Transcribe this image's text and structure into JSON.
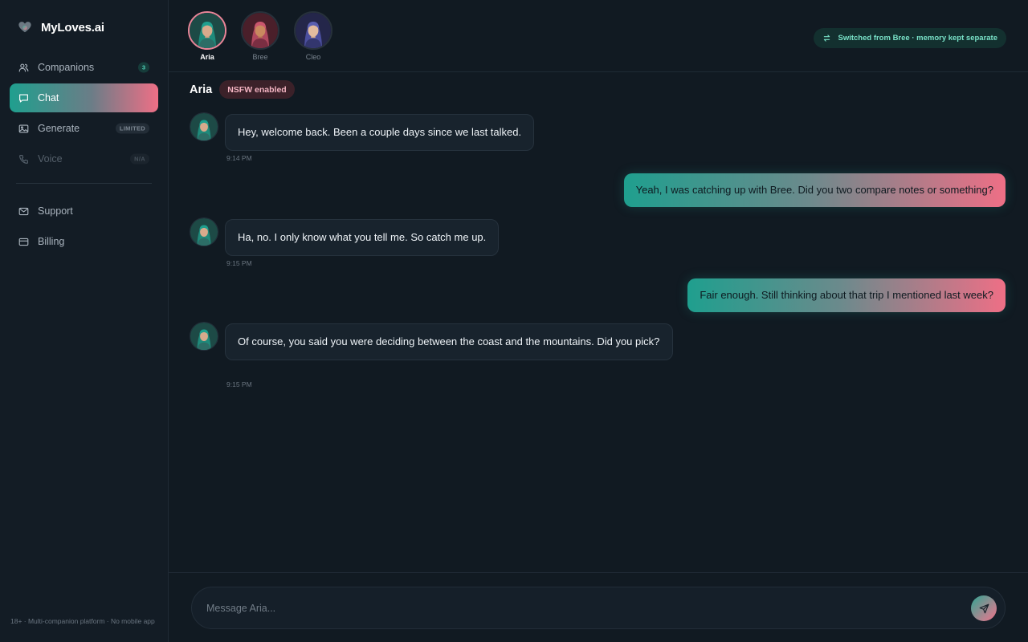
{
  "app": {
    "name": "MyLoves.ai"
  },
  "sidebar": {
    "items": [
      {
        "label": "Companions",
        "icon": "users-icon",
        "badge": "3"
      },
      {
        "label": "Chat",
        "icon": "chat-icon",
        "active": true
      },
      {
        "label": "Generate",
        "icon": "image-icon",
        "badge": "LIMITED"
      },
      {
        "label": "Voice",
        "icon": "phone-icon",
        "badge": "N/A",
        "disabled": true
      },
      {
        "label": "Support",
        "icon": "mail-icon"
      },
      {
        "label": "Billing",
        "icon": "credit-card-icon"
      }
    ],
    "footer": "18+ · Multi-companion platform · No mobile app"
  },
  "header": {
    "companions": [
      {
        "name": "Aria",
        "active": true,
        "color": "#1f9f8e"
      },
      {
        "name": "Bree",
        "color": "#c9566d"
      },
      {
        "name": "Cleo",
        "color": "#5a5fb0"
      }
    ],
    "switch_notice": "Switched from Bree · memory kept separate"
  },
  "chat": {
    "name": "Aria",
    "badge": "NSFW enabled",
    "messages": [
      {
        "from": "companion",
        "text": "Hey, welcome back. Been a couple days since we last talked.",
        "time": "9:14 PM"
      },
      {
        "from": "user",
        "text": "Yeah, I was catching up with Bree. Did you two compare notes or something?"
      },
      {
        "from": "companion",
        "text": "Ha, no. I only know what you tell me. So catch me up.",
        "time": "9:15 PM"
      },
      {
        "from": "user",
        "text": "Fair enough. Still thinking about that trip I mentioned last week?"
      },
      {
        "from": "companion",
        "text": "Of course, you said you were deciding between the coast and the mountains. Did you pick?",
        "time": "9:15 PM"
      }
    ]
  },
  "composer": {
    "placeholder": "Message Aria..."
  },
  "colors": {
    "accent_teal": "#1f9f8e",
    "accent_pink": "#ee6f86",
    "background": "#111a22"
  }
}
